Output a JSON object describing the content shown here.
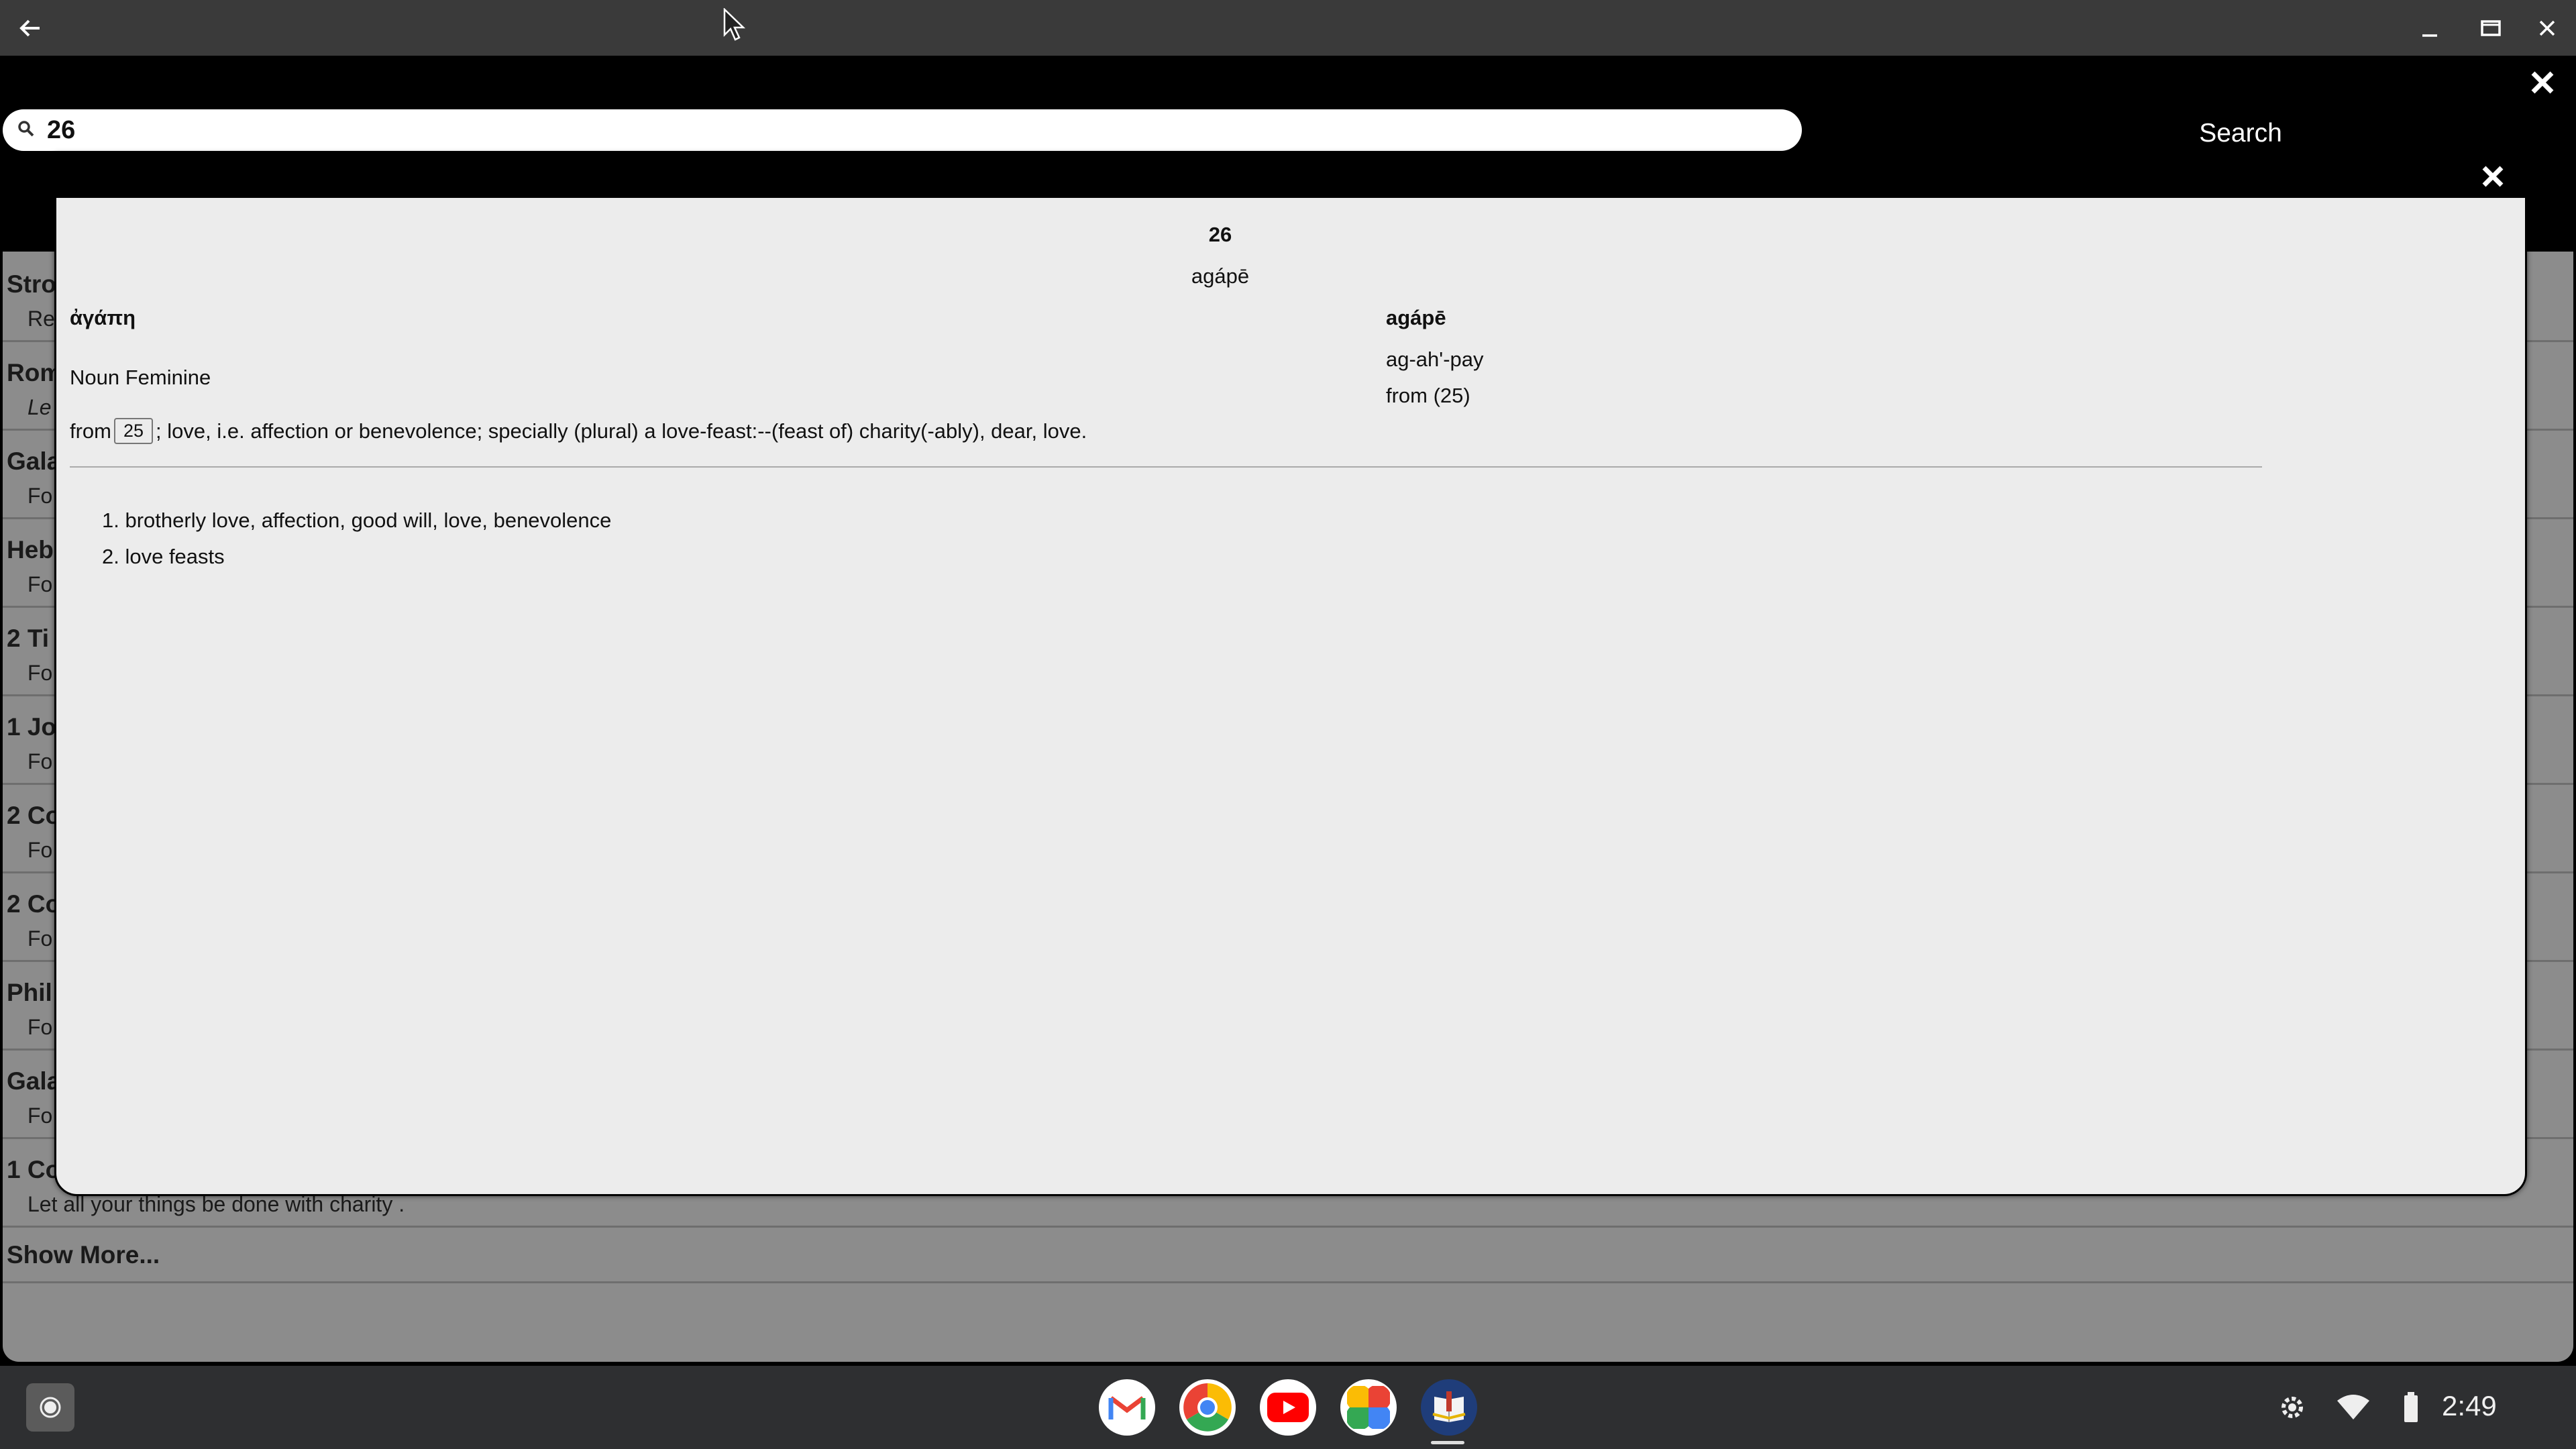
{
  "search": {
    "value": "26",
    "button_label": "Search"
  },
  "results": [
    {
      "title": "Stro",
      "text": "Re",
      "italic": false
    },
    {
      "title": "Rom",
      "text": "Le",
      "italic": true
    },
    {
      "title": "Gala",
      "text": "Fo",
      "italic": false
    },
    {
      "title": "Heb",
      "text": "Fo",
      "italic": false
    },
    {
      "title": "2 Ti",
      "text": "Fo",
      "italic": false
    },
    {
      "title": "1 Jo",
      "text": "Fo",
      "italic": false
    },
    {
      "title": "2 Co",
      "text": "Fo",
      "italic": false
    },
    {
      "title": "2 Co",
      "text": "Fo",
      "italic": false
    },
    {
      "title": "Phil",
      "text": "Fo",
      "italic": false
    },
    {
      "title": "Gala",
      "text": "Fo",
      "italic": false
    },
    {
      "title": "1 Co",
      "text": "Let all your things be done with charity .",
      "italic": false
    }
  ],
  "show_more": "Show More...",
  "entry": {
    "number": "26",
    "transliteration": "agápē",
    "greek": "ἀγάπη",
    "heading": "agápē",
    "pronunciation": "ag-ah'-pay",
    "from": "from (25)",
    "part_of_speech": "Noun Feminine",
    "definition_prefix": "from",
    "definition_ref": "25",
    "definition_rest": "; love, i.e. affection or benevolence; specially (plural) a love-feast:--(feast of) charity(-ably), dear, love.",
    "senses": [
      "1. brotherly love, affection, good will, love, benevolence",
      "2. love feasts"
    ]
  },
  "shelf": {
    "apps": [
      "gmail-icon",
      "chrome-icon",
      "youtube-icon",
      "photos-icon",
      "bible-app-icon"
    ],
    "time": "2:49"
  }
}
